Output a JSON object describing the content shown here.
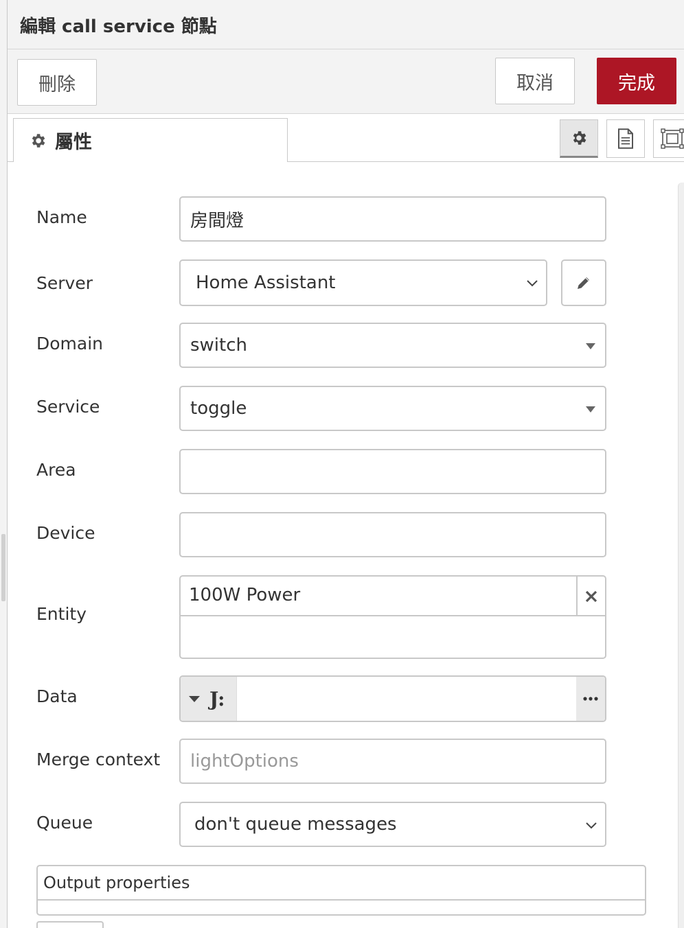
{
  "header": {
    "title": "編輯 call service 節點"
  },
  "toolbar": {
    "delete_label": "刪除",
    "cancel_label": "取消",
    "done_label": "完成",
    "done_color": "#ad1625"
  },
  "tabs": {
    "properties_label": "屬性",
    "icons": [
      "gear-icon",
      "description-icon",
      "appearance-icon"
    ]
  },
  "form": {
    "name": {
      "label": "Name",
      "value": "房間燈"
    },
    "server": {
      "label": "Server",
      "value": "Home Assistant"
    },
    "domain": {
      "label": "Domain",
      "value": "switch"
    },
    "service": {
      "label": "Service",
      "value": "toggle"
    },
    "area": {
      "label": "Area",
      "value": ""
    },
    "device": {
      "label": "Device",
      "value": ""
    },
    "entity": {
      "label": "Entity",
      "chip": "100W Power"
    },
    "data": {
      "label": "Data",
      "type_icon": "J:",
      "value": ""
    },
    "merge_context": {
      "label": "Merge context",
      "placeholder": "lightOptions"
    },
    "queue": {
      "label": "Queue",
      "value": "don't queue messages"
    },
    "output_properties": {
      "label": "Output properties"
    }
  }
}
